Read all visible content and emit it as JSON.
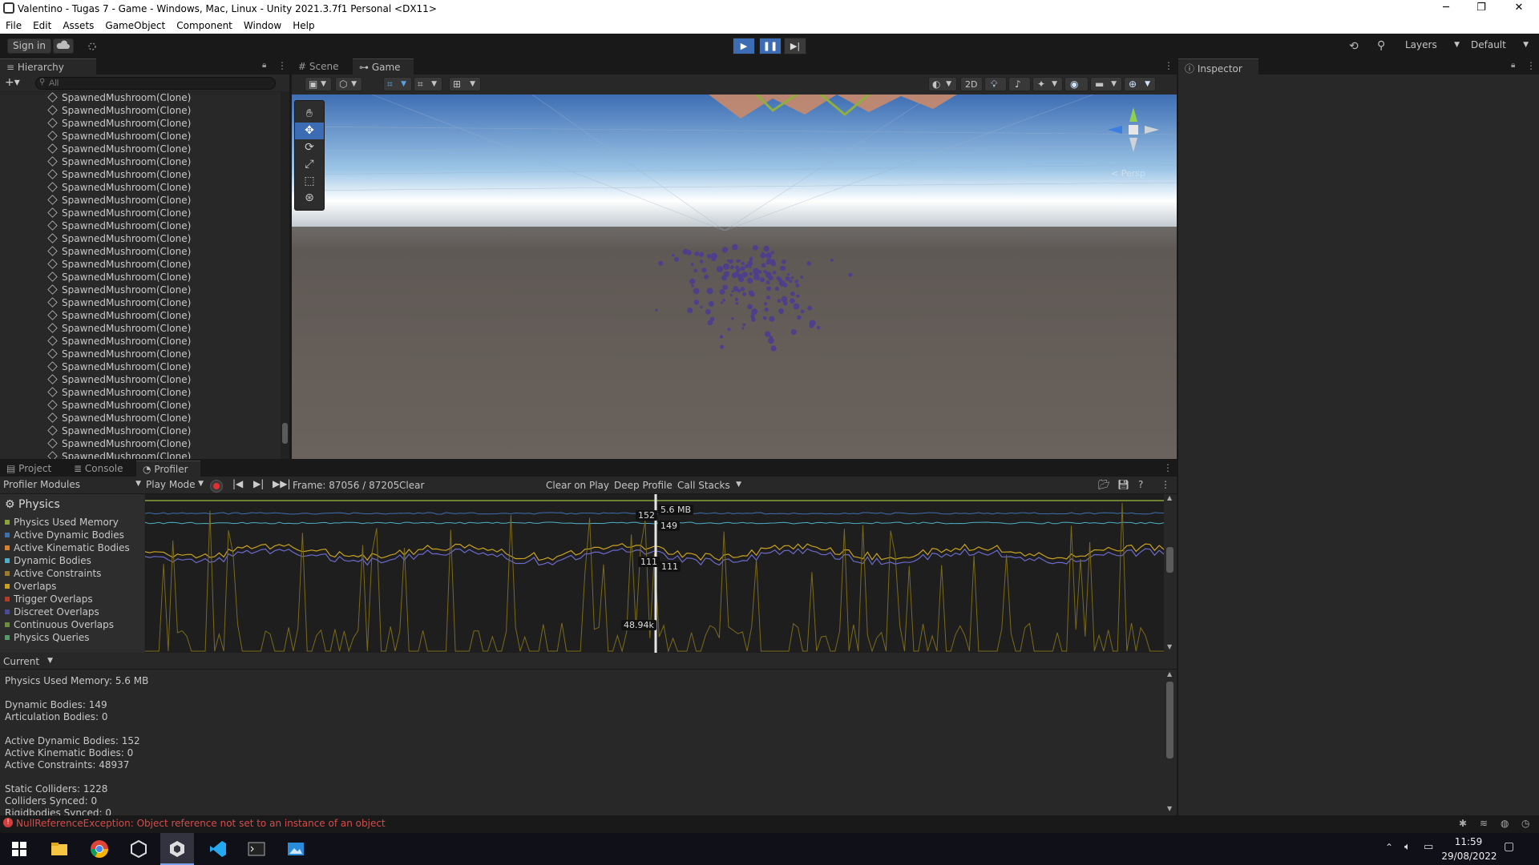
{
  "window": {
    "title": "Valentino - Tugas 7 - Game - Windows, Mac, Linux - Unity 2021.3.7f1 Personal <DX11>",
    "controls": [
      "─",
      "❐",
      "✕"
    ]
  },
  "menu": [
    "File",
    "Edit",
    "Assets",
    "GameObject",
    "Component",
    "Window",
    "Help"
  ],
  "toolbar": {
    "sign_in": "Sign in",
    "layers": "Layers",
    "layout": "Default"
  },
  "hierarchy": {
    "tab": "Hierarchy",
    "search_placeholder": "All",
    "items": [
      "SpawnedMushroom(Clone)",
      "SpawnedMushroom(Clone)",
      "SpawnedMushroom(Clone)",
      "SpawnedMushroom(Clone)",
      "SpawnedMushroom(Clone)",
      "SpawnedMushroom(Clone)",
      "SpawnedMushroom(Clone)",
      "SpawnedMushroom(Clone)",
      "SpawnedMushroom(Clone)",
      "SpawnedMushroom(Clone)",
      "SpawnedMushroom(Clone)",
      "SpawnedMushroom(Clone)",
      "SpawnedMushroom(Clone)",
      "SpawnedMushroom(Clone)",
      "SpawnedMushroom(Clone)",
      "SpawnedMushroom(Clone)",
      "SpawnedMushroom(Clone)",
      "SpawnedMushroom(Clone)",
      "SpawnedMushroom(Clone)",
      "SpawnedMushroom(Clone)",
      "SpawnedMushroom(Clone)",
      "SpawnedMushroom(Clone)",
      "SpawnedMushroom(Clone)",
      "SpawnedMushroom(Clone)",
      "SpawnedMushroom(Clone)",
      "SpawnedMushroom(Clone)",
      "SpawnedMushroom(Clone)",
      "SpawnedMushroom(Clone)",
      "SpawnedMushroom(Clone)"
    ]
  },
  "scene": {
    "tabs": [
      "Scene",
      "Game"
    ],
    "mode_2d": "2D",
    "persp": "< Persp"
  },
  "inspector": {
    "tab": "Inspector"
  },
  "bottom_tabs": [
    "Project",
    "Console",
    "Profiler"
  ],
  "profiler": {
    "modules_label": "Profiler Modules",
    "play_mode": "Play Mode",
    "frame": "Frame: 87056 / 87205",
    "clear": "Clear",
    "clear_on_play": "Clear on Play",
    "deep_profile": "Deep Profile",
    "call_stacks": "Call Stacks",
    "module_title": "Physics",
    "legend": [
      {
        "label": "Physics Used Memory",
        "color": "#8aa33a"
      },
      {
        "label": "Active Dynamic Bodies",
        "color": "#3f6fb0"
      },
      {
        "label": "Active Kinematic Bodies",
        "color": "#d9822b"
      },
      {
        "label": "Dynamic Bodies",
        "color": "#4db0c6"
      },
      {
        "label": "Active Constraints",
        "color": "#9b7b2a"
      },
      {
        "label": "Overlaps",
        "color": "#c7a21f"
      },
      {
        "label": "Trigger Overlaps",
        "color": "#b23b2b"
      },
      {
        "label": "Discreet Overlaps",
        "color": "#4b4b9a"
      },
      {
        "label": "Continuous Overlaps",
        "color": "#6a8e3a"
      },
      {
        "label": "Physics Queries",
        "color": "#5a9a6a"
      }
    ],
    "markers": {
      "memory": "5.6 MB",
      "active_dynamic": "152",
      "dynamic": "149",
      "discreet_a": "111",
      "discreet_b": "111",
      "constraints": "48.94k"
    },
    "view_mode": "Current",
    "stats": [
      "Physics Used Memory: 5.6 MB",
      "",
      "Dynamic Bodies: 149",
      "Articulation Bodies: 0",
      "",
      "Active Dynamic Bodies: 152",
      "Active Kinematic Bodies: 0",
      "Active Constraints: 48937",
      "",
      "Static Colliders: 1228",
      "Colliders Synced: 0",
      "Rigidbodies Synced: 0"
    ]
  },
  "status": {
    "error": "NullReferenceException: Object reference not set to an instance of an object"
  },
  "taskbar": {
    "time": "11:59",
    "date": "29/08/2022"
  }
}
